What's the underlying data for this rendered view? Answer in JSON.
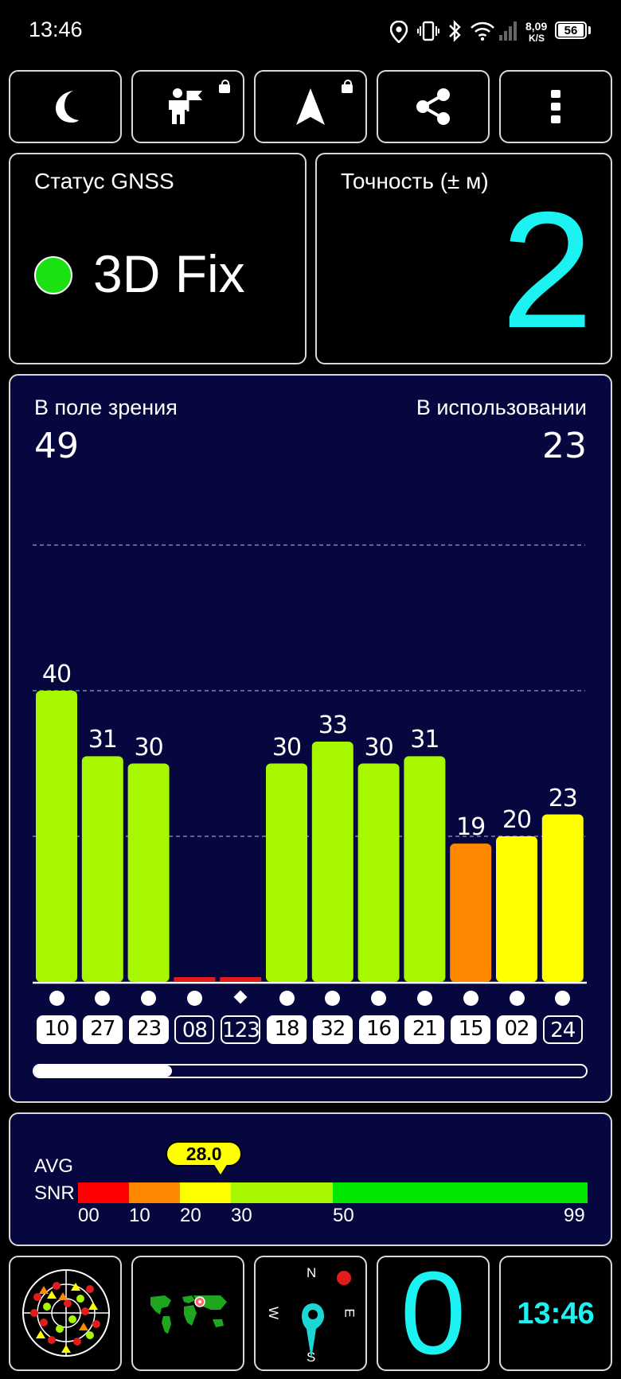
{
  "status_bar": {
    "time": "13:46",
    "net_speed": "8,09",
    "net_unit": "K/S",
    "battery": "56"
  },
  "toolbar": {
    "icons": [
      "moon-icon",
      "settings-person-flag-icon",
      "navigation-arrow-icon",
      "share-icon",
      "more-vert-icon"
    ]
  },
  "gnss": {
    "label": "Статус GNSS",
    "status": "3D Fix",
    "status_color": "#1be012"
  },
  "accuracy": {
    "label": "Точность (± м)",
    "value": "2",
    "color": "#1cf2f2"
  },
  "satellites": {
    "in_view_label": "В поле зрения",
    "in_view": "49",
    "used_label": "В использовании",
    "used": "23"
  },
  "chart_data": {
    "type": "bar",
    "categories": [
      "10",
      "27",
      "23",
      "08",
      "123",
      "18",
      "32",
      "16",
      "21",
      "15",
      "02",
      "24"
    ],
    "values": [
      40,
      31,
      30,
      0,
      0,
      30,
      33,
      30,
      31,
      19,
      20,
      23
    ],
    "value_labels": [
      "40",
      "31",
      "30",
      "",
      "",
      "30",
      "33",
      "30",
      "31",
      "19",
      "20",
      "23"
    ],
    "in_use": [
      true,
      true,
      true,
      false,
      false,
      true,
      true,
      true,
      true,
      true,
      true,
      false
    ],
    "markers": [
      "dot",
      "dot",
      "dot",
      "dot",
      "diamond",
      "dot",
      "dot",
      "dot",
      "dot",
      "dot",
      "dot",
      "dot"
    ],
    "colors": [
      "#a6f700",
      "#a6f700",
      "#a6f700",
      "#e21b1b",
      "#e21b1b",
      "#a6f700",
      "#a6f700",
      "#a6f700",
      "#a6f700",
      "#ff8800",
      "#ffff00",
      "#ffff00"
    ],
    "ylim": [
      0,
      60
    ],
    "gridlines": [
      20,
      40,
      60
    ],
    "scroll_position": 0.25
  },
  "snr": {
    "label_top": "AVG",
    "label_bottom": "SNR",
    "avg": "28.0",
    "avg_value": 28,
    "segments": [
      {
        "from": 0,
        "to": 10,
        "color": "#ff0000"
      },
      {
        "from": 10,
        "to": 20,
        "color": "#ff8800"
      },
      {
        "from": 20,
        "to": 30,
        "color": "#ffff00"
      },
      {
        "from": 30,
        "to": 50,
        "color": "#a6f700"
      },
      {
        "from": 50,
        "to": 99,
        "color": "#00e600"
      }
    ],
    "ticks": [
      "00",
      "10",
      "20",
      "30",
      "50",
      "99"
    ]
  },
  "bottom_tiles": {
    "satellites_fix_count": "0",
    "clock": "13:46",
    "compass": [
      "N",
      "E",
      "S",
      "W"
    ]
  }
}
